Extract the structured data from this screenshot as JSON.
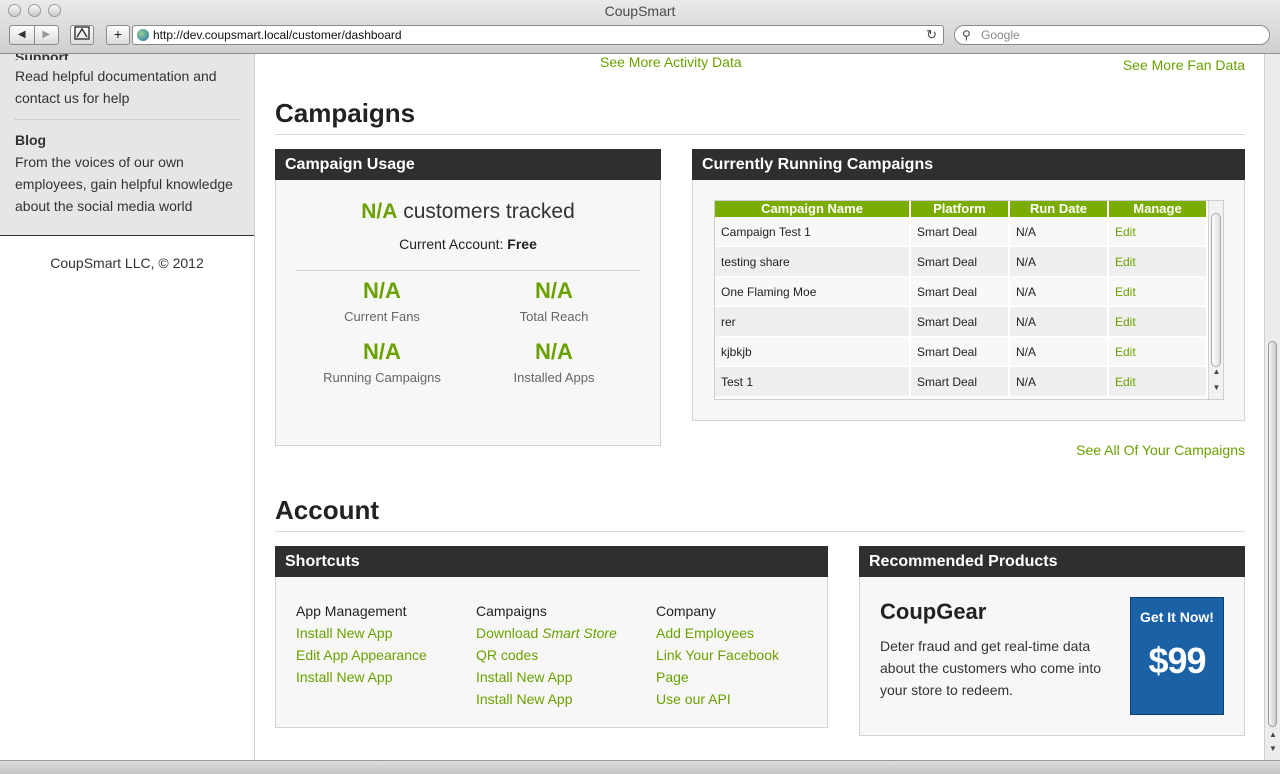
{
  "browser": {
    "window_title": "CoupSmart",
    "back_label": "◀",
    "forward_label": "▶",
    "add_label": "+",
    "url": "http://dev.coupsmart.local/customer/dashboard",
    "reload_label": "↻",
    "search_placeholder": "Google"
  },
  "sidebar": {
    "support_cut_text": "Support",
    "support_text": "Read helpful documentation and contact us for help",
    "blog_title": "Blog",
    "blog_text": "From the voices of our own employees, gain helpful knowledge about the social media world",
    "copyright": "CoupSmart LLC, © 2012"
  },
  "top_links": {
    "activity": "See More Activity Data",
    "fans": "See More Fan Data"
  },
  "campaigns": {
    "heading": "Campaigns",
    "usage": {
      "title": "Campaign Usage",
      "headline_value": "N/A",
      "headline_text": " customers tracked",
      "account_label": "Current Account: ",
      "account_value": "Free",
      "stats": [
        {
          "value": "N/A",
          "label": "Current Fans"
        },
        {
          "value": "N/A",
          "label": "Total Reach"
        },
        {
          "value": "N/A",
          "label": "Running Campaigns"
        },
        {
          "value": "N/A",
          "label": "Installed Apps"
        }
      ]
    },
    "running": {
      "title": "Currently Running Campaigns",
      "columns": [
        "Campaign Name",
        "Platform",
        "Run Date",
        "Manage"
      ],
      "rows": [
        {
          "name": "Campaign Test 1",
          "platform": "Smart Deal",
          "run_date": "N/A",
          "manage": "Edit"
        },
        {
          "name": "testing share",
          "platform": "Smart Deal",
          "run_date": "N/A",
          "manage": "Edit"
        },
        {
          "name": "One Flaming Moe",
          "platform": "Smart Deal",
          "run_date": "N/A",
          "manage": "Edit"
        },
        {
          "name": "rer",
          "platform": "Smart Deal",
          "run_date": "N/A",
          "manage": "Edit"
        },
        {
          "name": "kjbkjb",
          "platform": "Smart Deal",
          "run_date": "N/A",
          "manage": "Edit"
        },
        {
          "name": "Test 1",
          "platform": "Smart Deal",
          "run_date": "N/A",
          "manage": "Edit"
        }
      ],
      "scroll_up": "▲",
      "scroll_down": "▼"
    },
    "see_all": "See All Of Your Campaigns"
  },
  "account": {
    "heading": "Account",
    "shortcuts": {
      "title": "Shortcuts",
      "col1": {
        "header": "App Management",
        "links": [
          "Install New App",
          "Edit App Appearance",
          "Install New App"
        ]
      },
      "col2": {
        "header": "Campaigns",
        "link_download_prefix": "Download ",
        "link_download_em": "Smart Store",
        "links": [
          "QR codes",
          "Install New App",
          "Install New App"
        ]
      },
      "col3": {
        "header": "Company",
        "links": [
          "Add Employees",
          "Link Your Facebook Page",
          "Use our API"
        ]
      }
    },
    "recommended": {
      "title": "Recommended Products",
      "product_name": "CoupGear",
      "description": "Deter fraud and get real-time data about the customers who come into your store to redeem.",
      "cta_text": "Get It Now!",
      "price": "$99"
    }
  },
  "colors": {
    "accent_green": "#6aa100",
    "table_header_green": "#7bac00",
    "panel_header": "#2f2f2f",
    "cta_blue": "#1b61a6"
  }
}
